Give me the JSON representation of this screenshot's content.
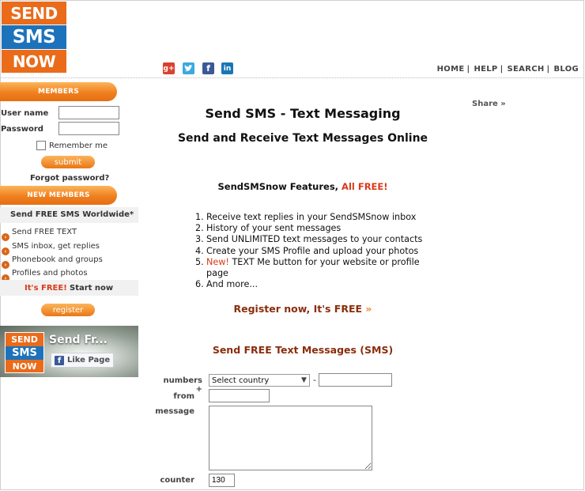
{
  "logo": {
    "line1": "SEND",
    "line2": "SMS",
    "line3": "NOW"
  },
  "social": {
    "googleplus": "g+",
    "twitter": "t",
    "facebook": "f",
    "linkedin": "in"
  },
  "topnav": [
    "HOME",
    "HELP",
    "SEARCH",
    "BLOG"
  ],
  "topnav_sep": "|",
  "members": {
    "header": "MEMBERS",
    "username_label": "User name",
    "password_label": "Password",
    "username_value": "",
    "password_value": "",
    "remember_label": "Remember me",
    "submit_label": "submit",
    "forgot_label": "Forgot password?"
  },
  "new_members": {
    "header": "NEW MEMBERS",
    "tagline": "Send FREE SMS Worldwide*",
    "items": [
      "Send FREE TEXT",
      "SMS inbox, get replies",
      "Phonebook and groups",
      "Profiles and photos"
    ],
    "free_text": "It's FREE!",
    "start_now": "Start now",
    "register_label": "register"
  },
  "fb_widget": {
    "logo1": "SEND",
    "logo2": "SMS",
    "logo3": "NOW",
    "title": "Send Fr...",
    "like_label": "Like Page"
  },
  "main": {
    "title": "Send SMS - Text Messaging",
    "subtitle": "Send and Receive Text Messages Online",
    "share": "Share »",
    "features_title_prefix": "SendSMSnow Features,",
    "features_title_suffix": "All FREE!",
    "features": [
      {
        "num": "1.",
        "text": "Receive text replies in your SendSMSnow inbox",
        "new": ""
      },
      {
        "num": "2.",
        "text": "History of your sent messages",
        "new": ""
      },
      {
        "num": "3.",
        "text": "Send UNLIMITED text messages to your contacts",
        "new": ""
      },
      {
        "num": "4.",
        "text": "Create your SMS Profile and upload your photos",
        "new": ""
      },
      {
        "num": "5.",
        "text": "TEXT Me button for your website or profile page",
        "new": "New!"
      },
      {
        "num": "6.",
        "text": "And more...",
        "new": ""
      }
    ],
    "register_now": "Register now, It's FREE",
    "register_quote": "»",
    "sms_title": "Send FREE Text Messages (SMS)"
  },
  "form": {
    "numbers_label": "numbers +",
    "country_selected": "Select country",
    "dash": "-",
    "number_value": "",
    "from_label": "from",
    "from_value": "",
    "message_label": "message",
    "message_value": "",
    "counter_label": "counter",
    "counter_value": "130"
  },
  "colors": {
    "orange": "#f0801f",
    "blue": "#1d73bb",
    "dark_red": "#8a2d0c",
    "red": "#d83a1a"
  }
}
